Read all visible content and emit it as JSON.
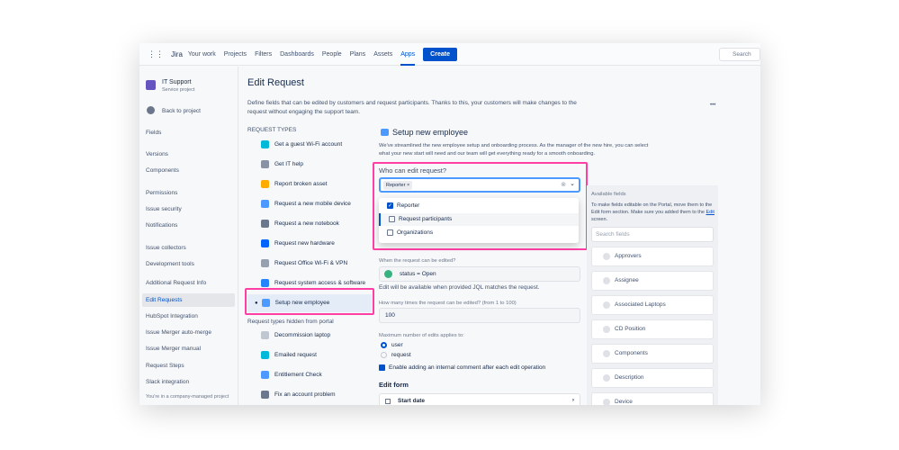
{
  "topbar": {
    "logo": "Jira",
    "nav": [
      "Your work",
      "Projects",
      "Filters",
      "Dashboards",
      "People",
      "Plans",
      "Assets"
    ],
    "apps": "Apps",
    "create": "Create",
    "search": "Search"
  },
  "sidebar": {
    "project": "IT Support",
    "project_type": "Service project",
    "back": "Back to project",
    "items": [
      "Fields",
      "Versions",
      "Components",
      "Permissions",
      "Issue security",
      "Notifications",
      "Issue collectors",
      "Development tools",
      "Additional Request Info",
      "Edit Requests",
      "HubSpot Integration",
      "Issue Merger auto-merge",
      "Issue Merger manual",
      "Request Steps",
      "Slack integration"
    ],
    "footer": "You're in a company-managed project"
  },
  "page": {
    "title": "Edit Request",
    "description": "Define fields that can be edited by customers and request participants. Thanks to this, your customers will make changes to the request without engaging the support team.",
    "more": "•••"
  },
  "request_types": {
    "heading": "REQUEST TYPES",
    "items": [
      "Get a guest Wi-Fi account",
      "Get IT help",
      "Report broken asset",
      "Request a new mobile device",
      "Request a new notebook",
      "Request new hardware",
      "Request Office Wi-Fi & VPN",
      "Request system access & software",
      "Setup new employee"
    ],
    "hidden_heading": "Request types hidden from portal",
    "hidden_items": [
      "Decommission laptop",
      "Emailed request",
      "Entitlement Check",
      "Fix an account problem"
    ]
  },
  "form": {
    "title": "Setup new employee",
    "description": "We've streamlined the new employee setup and onboarding process. As the manager of the new hire, you can select what your new start will need and our team will get everything ready for a smooth onboarding.",
    "who_label": "Who can edit request?",
    "tag": "Reporter",
    "options": [
      {
        "label": "Reporter",
        "checked": true
      },
      {
        "label": "Request participants",
        "checked": false
      },
      {
        "label": "Organizations",
        "checked": false
      }
    ],
    "when_label": "When the request can be edited?",
    "jql": "status = Open",
    "jql_help": "Edit will be available when provided JQL matches the request.",
    "times_label": "How many times the request can be edited? (from 1 to 100)",
    "times_value": "100",
    "applies_label": "Maximum number of edits applies to:",
    "radio_user": "user",
    "radio_request": "request",
    "comment_label": "Enable adding an internal comment after each edit operation",
    "edit_form": "Edit form",
    "start_date": "Start date"
  },
  "available": {
    "heading": "Available fields",
    "help_pre": "To make fields editable on the Portal, move them to the Edit form section. Make sure you added them to the ",
    "help_link": "Edit",
    "help_post": " screen.",
    "search_placeholder": "Search fields",
    "fields": [
      "Approvers",
      "Assignee",
      "Associated Laptops",
      "CD Position",
      "Components",
      "Description",
      "Device"
    ]
  }
}
